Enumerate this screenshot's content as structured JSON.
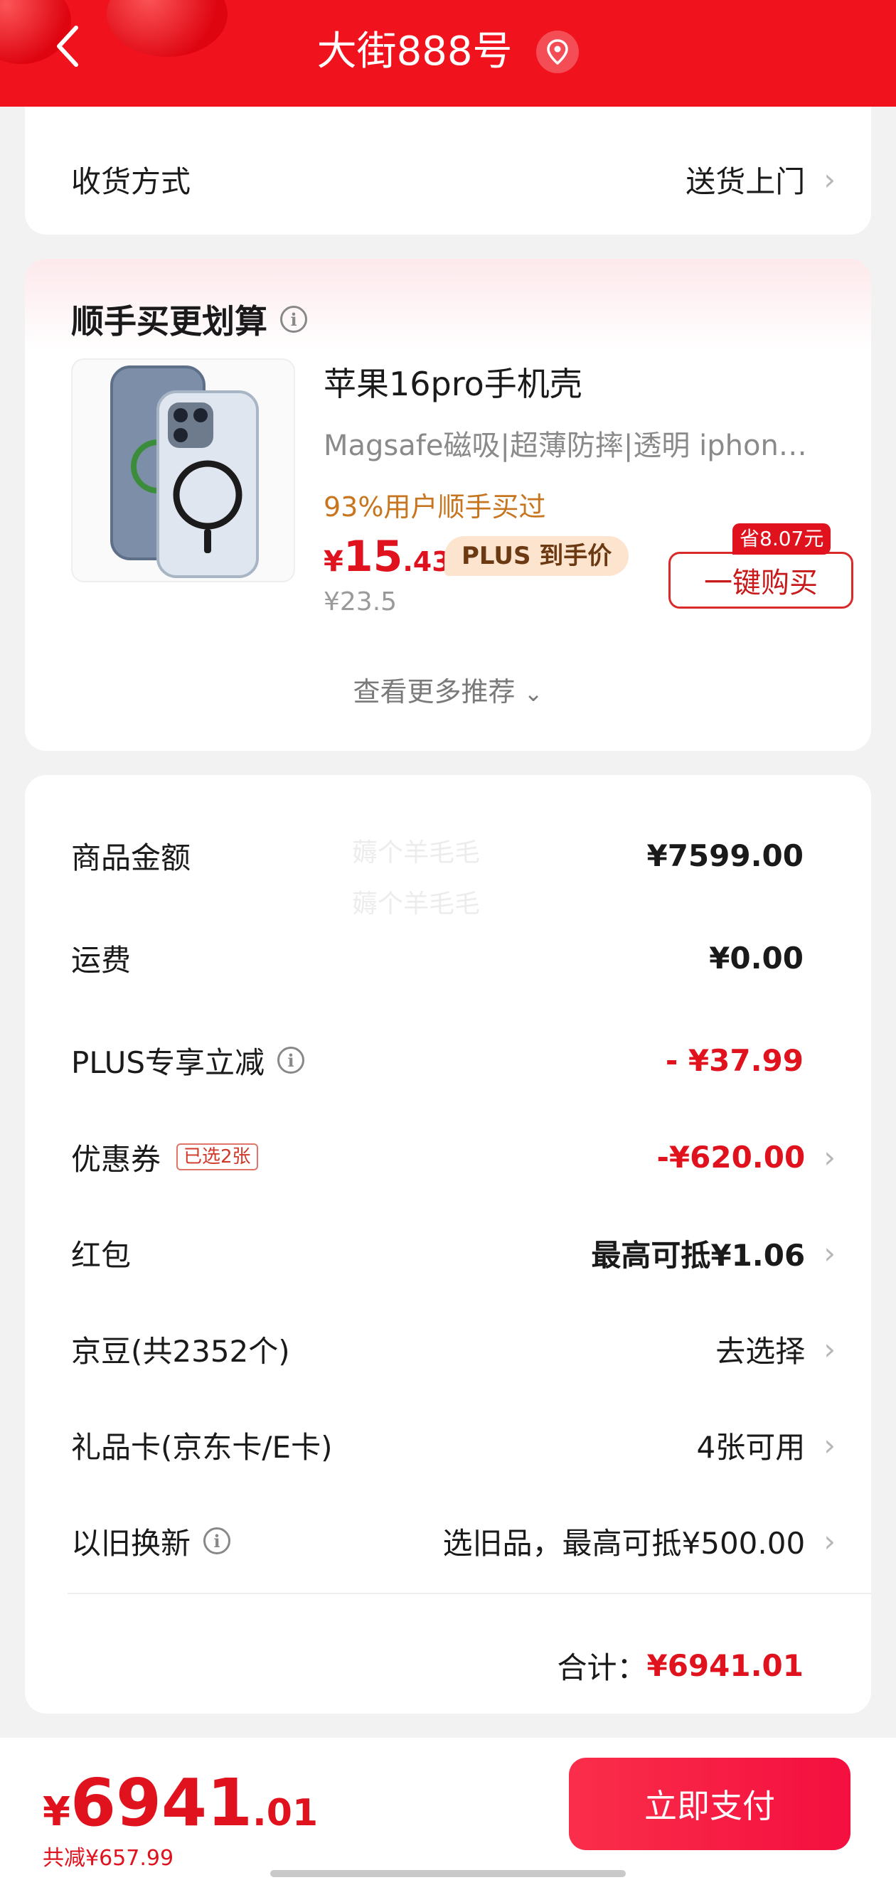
{
  "header": {
    "title": "大街888号"
  },
  "delivery": {
    "label": "收货方式",
    "value": "送货上门"
  },
  "recommend": {
    "title": "顺手买更划算",
    "product": {
      "name": "苹果16pro手机壳",
      "desc": "Magsafe磁吸|超薄防摔|透明   iphon…",
      "stat": "93%用户顺手买过",
      "price_symbol": "¥",
      "price_int": "15",
      "price_dec": ".43",
      "plus_tag": "PLUS 到手价",
      "orig_price": "¥23.5",
      "save_badge": "省8.07元",
      "buy_label": "一键购买"
    },
    "more": "查看更多推荐"
  },
  "summary": {
    "watermark": "薅个羊毛毛",
    "goods_amount": {
      "label": "商品金额",
      "value": "¥7599.00"
    },
    "shipping": {
      "label": "运费",
      "value": "¥0.00"
    },
    "plus_discount": {
      "label": "PLUS专享立减",
      "value": "- ¥37.99"
    },
    "coupon": {
      "label": "优惠券",
      "badge": "已选2张",
      "value": "-¥620.00"
    },
    "red_packet": {
      "label": "红包",
      "value": "最高可抵¥1.06"
    },
    "jd_beans": {
      "label": "京豆(共2352个)",
      "value": "去选择"
    },
    "gift_card": {
      "label": "礼品卡(京东卡/E卡)",
      "value": "4张可用"
    },
    "trade_in": {
      "label": "以旧换新",
      "value": "选旧品，最高可抵¥500.00"
    },
    "total_label": "合计：",
    "total_value": "¥6941.01"
  },
  "bottom": {
    "price_symbol": "¥",
    "price_int": "6941",
    "price_dec": ".01",
    "saved": "共减¥657.99",
    "pay_label": "立即支付"
  },
  "colors": {
    "brand_red": "#f0121d",
    "price_red": "#e0121d",
    "plus_gold": "#fde4cf"
  }
}
